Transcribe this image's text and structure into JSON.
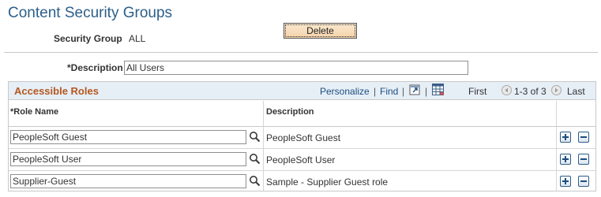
{
  "page": {
    "title": "Content Security Groups"
  },
  "security_group": {
    "label": "Security Group",
    "value": "ALL"
  },
  "delete_button": {
    "label": "Delete"
  },
  "description": {
    "label": "*Description",
    "value": "All Users"
  },
  "grid": {
    "title": "Accessible Roles",
    "nav": {
      "personalize": "Personalize",
      "sep1": "|",
      "find": "Find",
      "sep2": "|",
      "sep3": "|",
      "first": "First",
      "range": "1-3 of 3",
      "last": "Last"
    },
    "columns": {
      "role_name": "*Role Name",
      "description": "Description"
    },
    "rows": [
      {
        "role": "PeopleSoft Guest",
        "description": "PeopleSoft Guest"
      },
      {
        "role": "PeopleSoft User",
        "description": "PeopleSoft User"
      },
      {
        "role": "Supplier-Guest",
        "description": "Sample - Supplier Guest role"
      }
    ]
  },
  "colors": {
    "title_blue": "#2c5f8a",
    "grid_title_orange": "#b5581e",
    "grid_header_bg": "#e6eef6",
    "link_blue": "#1c4e80",
    "button_bg": "#f3d3aa"
  },
  "icons": {
    "zoom": "zoom-icon",
    "grid_view": "grid-view-icon",
    "prev": "previous-arrow-icon",
    "next": "next-arrow-icon",
    "lookup": "lookup-icon",
    "add_row": "add-row-icon",
    "delete_row": "delete-row-icon"
  }
}
